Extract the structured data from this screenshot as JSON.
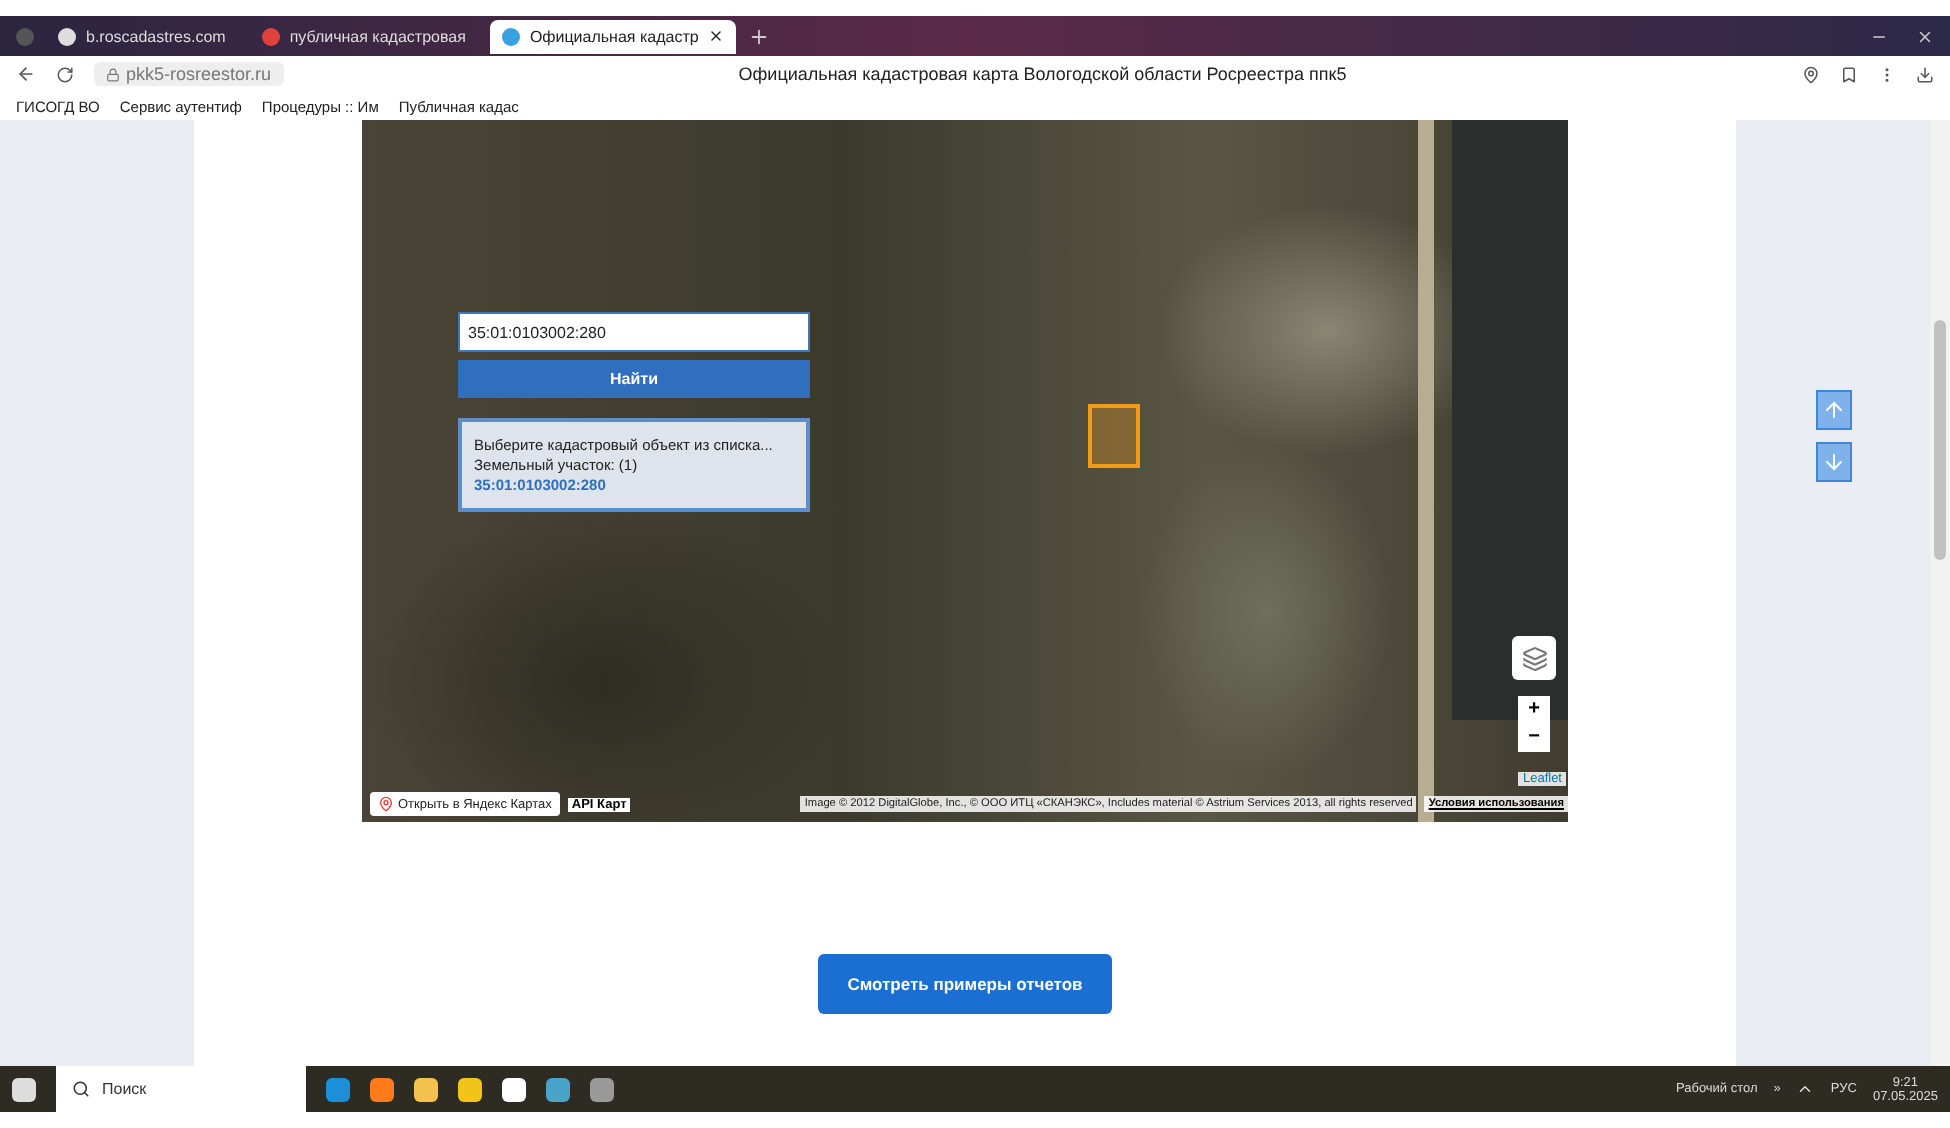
{
  "browser": {
    "tabs": [
      {
        "label": "b.roscadastres.com",
        "selected": false
      },
      {
        "label": "публичная кадастровая",
        "selected": false
      },
      {
        "label": "Официальная кадастр",
        "selected": true
      }
    ],
    "address": "pkk5-rosreestor.ru",
    "page_title": "Официальная кадастровая карта Вологодской области Росреестра ппк5",
    "bookmarks": [
      "ГИСОГД ВО",
      "Сервис аутентиф",
      "Процедуры :: Им",
      "Публичная кадас"
    ]
  },
  "map": {
    "search": {
      "value": "35:01:0103002:280"
    },
    "find_button": "Найти",
    "results": {
      "hint": "Выберите кадастровый объект из списка...",
      "group": "Земельный участок: (1)",
      "link": "35:01:0103002:280"
    },
    "zoom_in": "+",
    "zoom_out": "−",
    "leaflet": "Leaflet",
    "yandex_link": "Открыть в Яндекс Картах",
    "api_link": "API Карт",
    "attribution": "Image © 2012 DigitalGlobe, Inc., © ООО ИТЦ «СКАНЭКС», Includes material © Astrium Services 2013, all rights reserved",
    "terms": "Условия использования"
  },
  "cta_button": "Смотреть примеры отчетов",
  "taskbar": {
    "search_placeholder": "Поиск",
    "desktop": "Рабочий стол",
    "chevron": "»",
    "language": "РУС",
    "time": "9:21",
    "date": "07.05.2025"
  }
}
